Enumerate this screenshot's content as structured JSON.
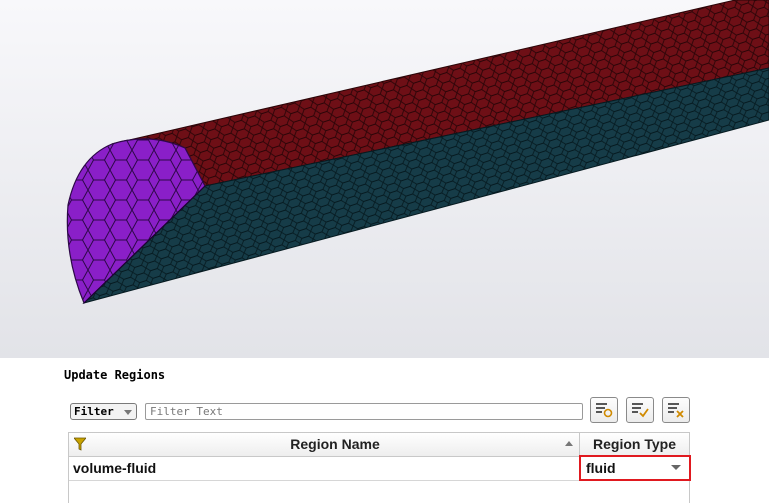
{
  "viewport": {
    "description_icon": "cfd-mesh-half-cylinder",
    "colors": {
      "cap": "#7f1ab8",
      "top_face": "#6e0f16",
      "side_face": "#163c48",
      "background_top": "#f8f8fb",
      "background_bottom": "#e2e3e8"
    }
  },
  "panel": {
    "title": "Update Regions",
    "filter": {
      "label": "Filter",
      "placeholder": "Filter Text",
      "value": ""
    },
    "toolbar": [
      "select-all-icon",
      "apply-icon",
      "clear-icon"
    ],
    "table": {
      "columns": [
        "Region Name",
        "Region Type"
      ],
      "rows": [
        {
          "name": "volume-fluid",
          "type": "fluid"
        }
      ]
    },
    "highlight_color": "#e0191f"
  }
}
